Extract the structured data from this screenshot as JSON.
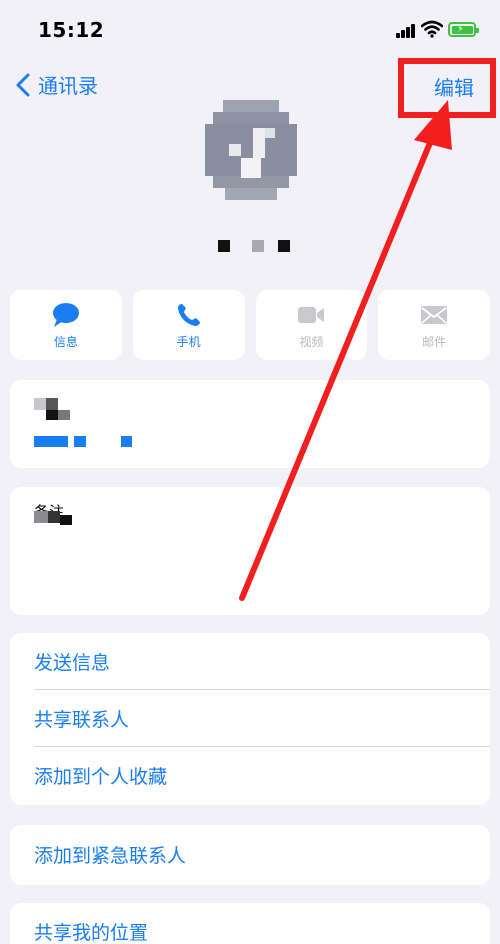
{
  "status_bar": {
    "time": "15:12"
  },
  "nav": {
    "back_label": "通讯录",
    "edit_label": "编辑"
  },
  "actions": [
    {
      "label": "信息",
      "icon": "message-bubble-icon",
      "enabled": true
    },
    {
      "label": "手机",
      "icon": "phone-icon",
      "enabled": true
    },
    {
      "label": "视频",
      "icon": "video-camera-icon",
      "enabled": false
    },
    {
      "label": "邮件",
      "icon": "mail-icon",
      "enabled": false
    }
  ],
  "notes": {
    "label": "备注"
  },
  "list_group_1": [
    {
      "label": "发送信息"
    },
    {
      "label": "共享联系人"
    },
    {
      "label": "添加到个人收藏"
    }
  ],
  "list_group_2": [
    {
      "label": "添加到紧急联系人"
    }
  ],
  "list_group_3": [
    {
      "label": "共享我的位置"
    }
  ],
  "colors": {
    "accent": "#1a7ef2",
    "annotation": "#f21f1f",
    "disabled": "#b9b9be",
    "background": "#f2f1f7"
  }
}
